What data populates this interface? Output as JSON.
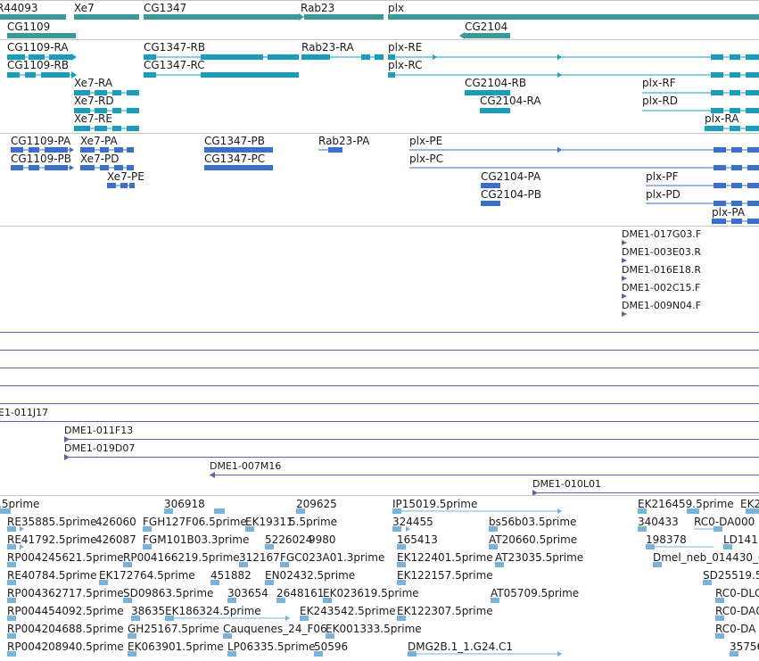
{
  "colors": {
    "gene": "#3a9a9a",
    "transcript_fb": "#1a9dbb",
    "transcript_ncbi": "#3a6fcc",
    "bac": "#6f5aa8",
    "est": "#79b3d8",
    "separator": "#c4c4c4"
  },
  "gene_track": {
    "labels": [
      "R44093",
      "CG1109",
      "Xe7",
      "CG1347",
      "Rab23",
      "plx",
      "CG2104"
    ]
  },
  "flybase_track": {
    "labels": [
      "CG1109-RA",
      "CG1347-RB",
      "Rab23-RA",
      "plx-RE",
      "CG1109-RB",
      "CG1347-RC",
      "plx-RC",
      "Xe7-RA",
      "CG2104-RB",
      "plx-RF",
      "Xe7-RD",
      "CG2104-RA",
      "plx-RD",
      "Xe7-RE",
      "plx-RA"
    ]
  },
  "ncbi_track": {
    "labels": [
      "CG1109-PA",
      "Xe7-PA",
      "CG1347-PB",
      "Rab23-PA",
      "plx-PE",
      "CG1109-PB",
      "Xe7-PD",
      "CG1347-PC",
      "plx-PC",
      "Xe7-PE",
      "CG2104-PA",
      "plx-PF",
      "CG2104-PB",
      "plx-PD",
      "plx-PA"
    ]
  },
  "bac_track": {
    "labels": [
      "DME1-017G03.F",
      "DME1-003E03.R",
      "DME1-016E18.R",
      "DME1-002C15.F",
      "DME1-009N04.F",
      "E1-011J17",
      "DME1-011F13",
      "DME1-019D07",
      "DME1-007M16",
      "DME1-010L01"
    ]
  },
  "est_track": {
    "labels": [
      ".5prime",
      "306918",
      "209625",
      "IP15019.5prime",
      "EK216459.5prime",
      "EK2",
      "RE35885.5prime",
      "426060",
      "FGH127F06.5prime",
      "EK19311",
      "5.5prime",
      "324455",
      "bs56b03.5prime",
      "340433",
      "RC0-DA000",
      "RE41792.5prime",
      "426087",
      "FGM101B03.3prime",
      "5226024",
      "9980",
      "165413",
      "AT20660.5prime",
      "198378",
      "LD141",
      "RP004245621.5prime",
      "RP004166219.5prime",
      "312167",
      "FGC023A01.3prime",
      "EK122401.5prime",
      "AT23035.5prime",
      "Dmel_neb_014430_G",
      "RE40784.5prime",
      "EK172764.5prime",
      "451882",
      "EN02432.5prime",
      "EK122157.5prime",
      "SD25519.5",
      "RP004362717.5prime",
      "SD09863.5prime",
      "303654",
      "2648161",
      "EK023619.5prime",
      "AT05709.5prime",
      "RC0-DLC",
      "RP004454092.5prime",
      "38635",
      "EK186324.5prime",
      "EK243542.5prime",
      "EK122307.5prime",
      "RC0-DA0",
      "RP004204688.5prime",
      "GH25167.5prime",
      "Cauquenes_24_F06",
      "EK001333.5prime",
      "RC0-DA",
      "RP004208940.5prime",
      "EK063901.5prime",
      "LP06335.5prime",
      "50596",
      "DMG2B.1_1.G24.C1",
      "35756"
    ]
  }
}
